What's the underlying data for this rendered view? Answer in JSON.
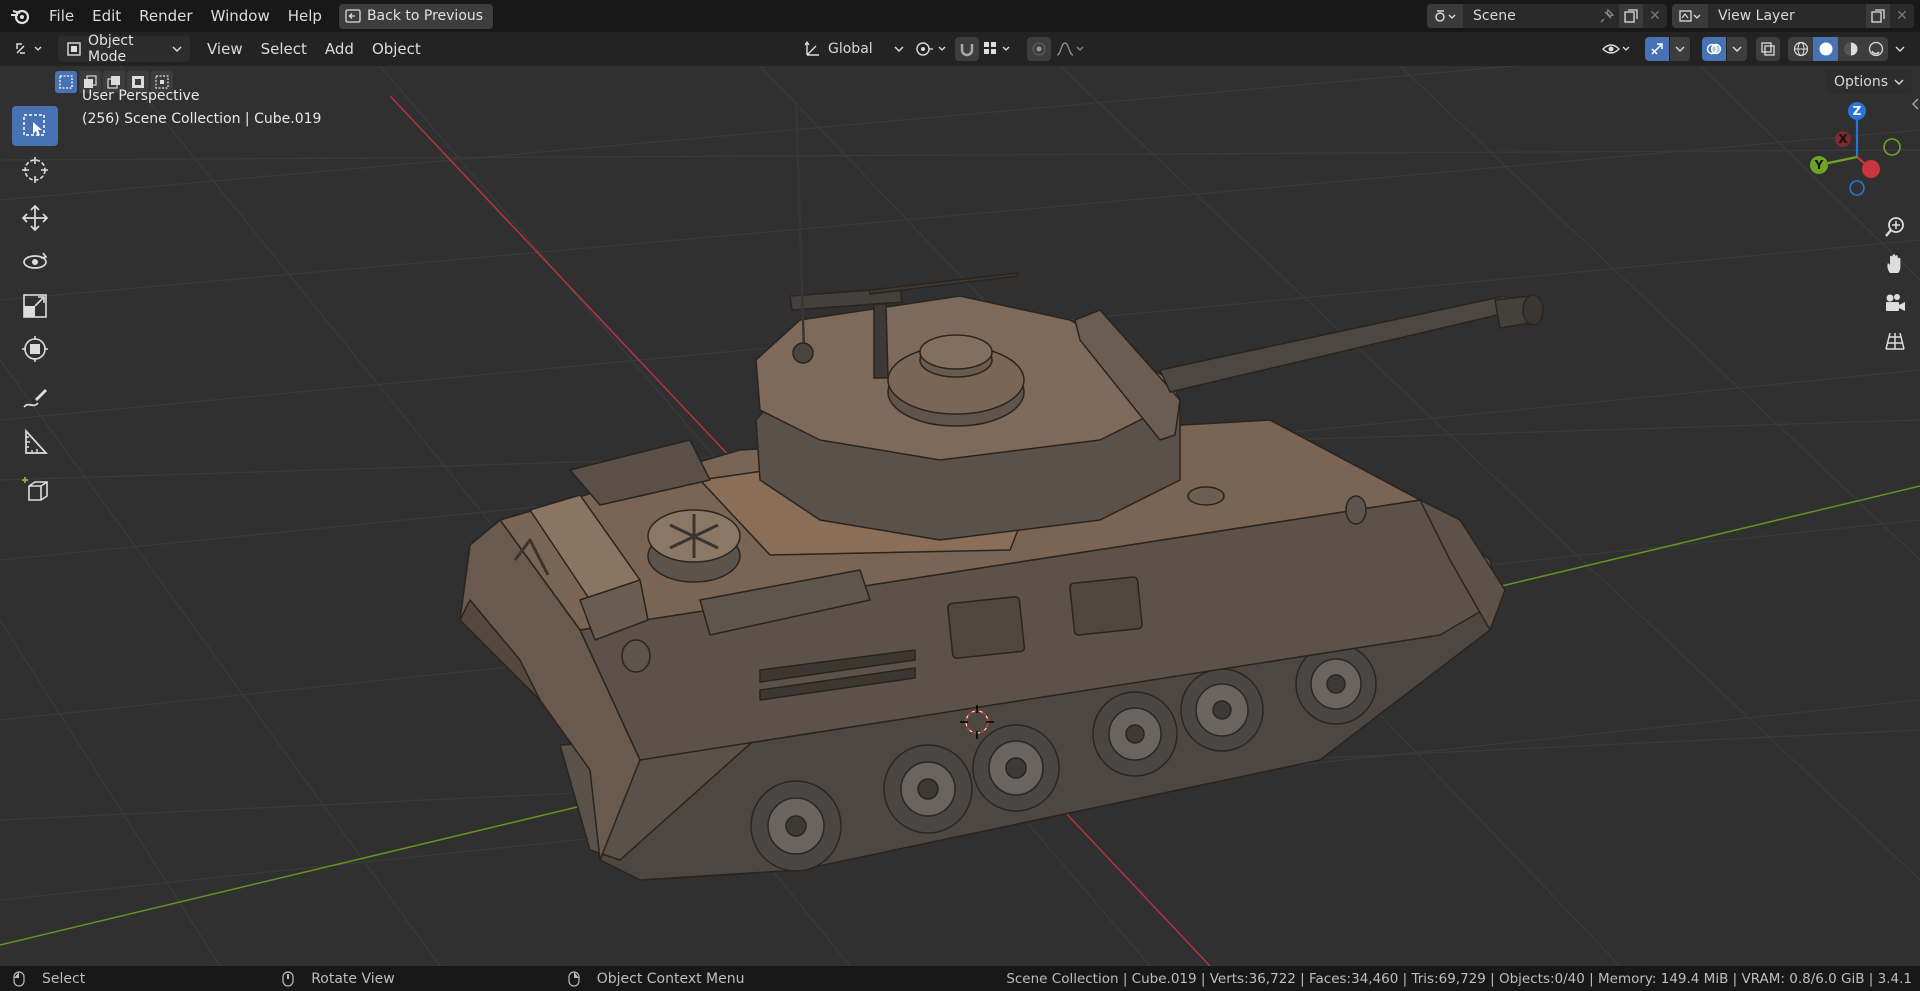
{
  "topbar": {
    "menus": [
      "File",
      "Edit",
      "Render",
      "Window",
      "Help"
    ],
    "back_button": "Back to Previous",
    "scene_name": "Scene",
    "view_layer": "View Layer"
  },
  "header": {
    "mode": "Object Mode",
    "menus": [
      "View",
      "Select",
      "Add",
      "Object"
    ],
    "transform_orientation": "Global",
    "options": "Options"
  },
  "viewport": {
    "view_name": "User Perspective",
    "collection_info": "(256) Scene Collection | Cube.019",
    "gizmo_axes": {
      "x": "X",
      "y": "Y",
      "z": "Z"
    }
  },
  "statusbar": {
    "hint_select": "Select",
    "hint_rotate": "Rotate View",
    "hint_context": "Object Context Menu",
    "stats": "Scene Collection | Cube.019 | Verts:36,722 | Faces:34,460 | Tris:69,729 | Objects:0/40 | Memory: 149.4 MiB | VRAM: 0.8/6.0 GiB | 3.4.1"
  },
  "colors": {
    "accent": "#4772b3",
    "x_axis": "#c9363f",
    "y_axis": "#6ea424",
    "z_axis": "#2b73d6",
    "tank": "#7a6453",
    "viewport_bg": "#303030"
  },
  "icons": [
    "blender-logo-icon",
    "select-box-icon",
    "cursor-icon",
    "move-icon",
    "rotate-icon",
    "scale-icon",
    "transform-icon",
    "annotate-icon",
    "measure-icon",
    "add-cube-icon",
    "zoom-icon",
    "hand-icon",
    "camera-icon",
    "grid-icon"
  ]
}
